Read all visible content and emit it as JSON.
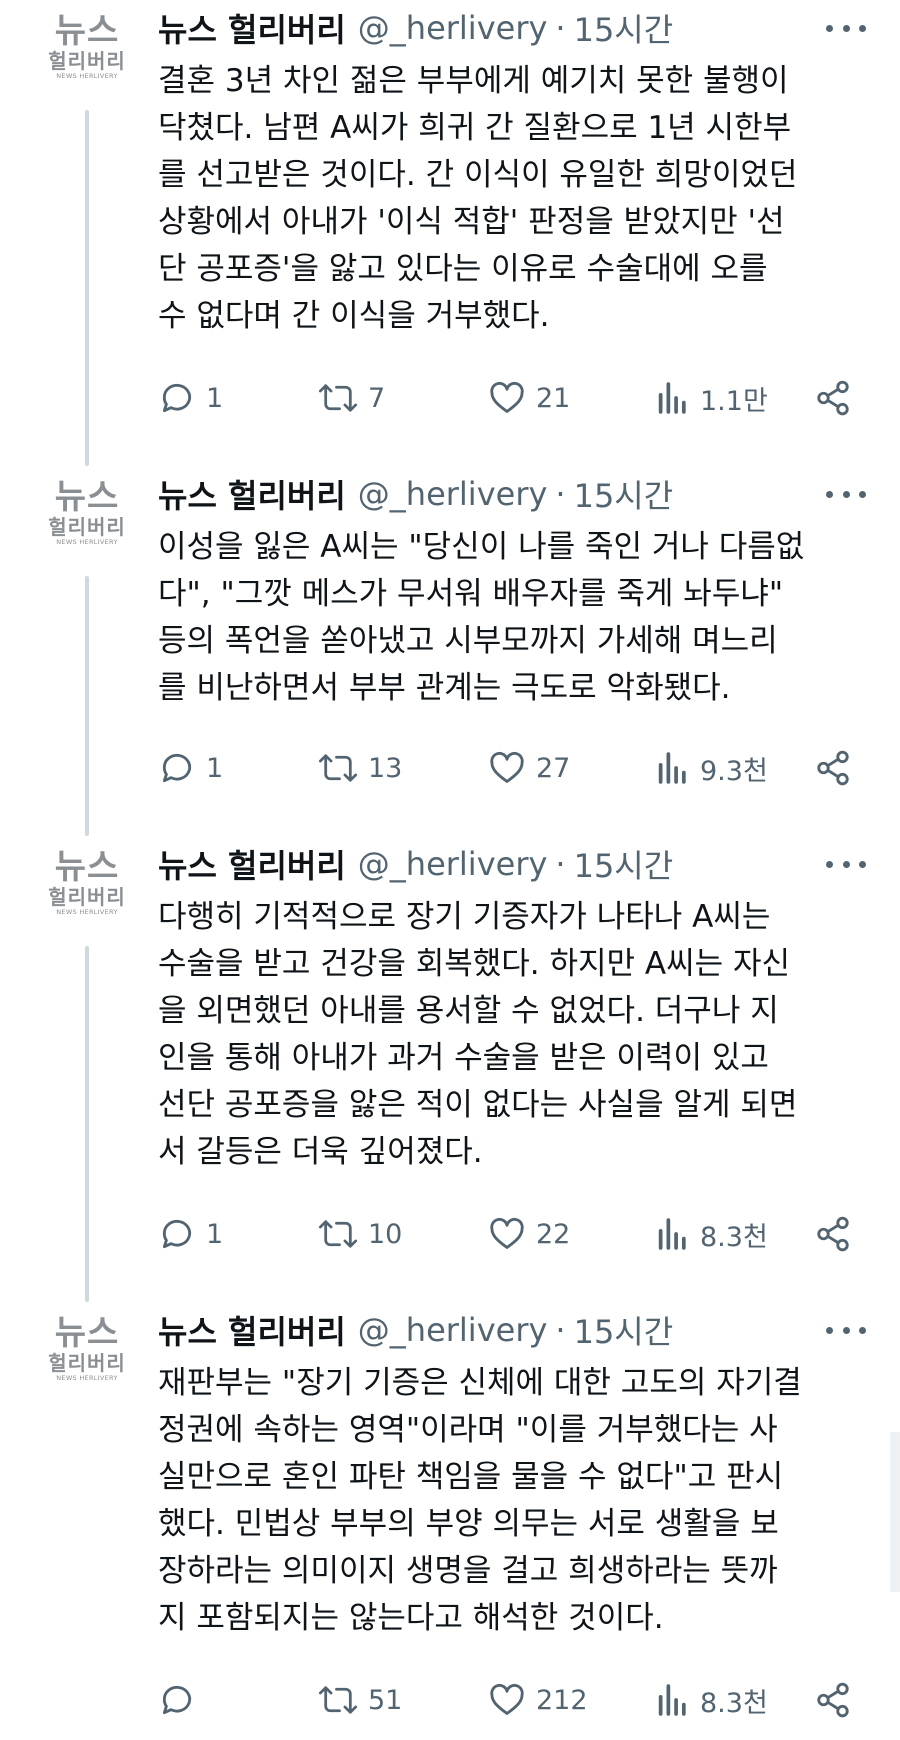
{
  "author": {
    "name": "뉴스 헐리버리",
    "handle": "@_herlivery",
    "avatar_line1": "뉴스",
    "avatar_line2": "헐리버리",
    "avatar_line3": "NEWS HERLIVERY"
  },
  "separator": "·",
  "tweets": [
    {
      "time": "15시간",
      "text": "결혼 3년 차인 젊은 부부에게 예기치 못한 불행이\n닥쳤다. 남편 A씨가 희귀 간 질환으로 1년 시한부\n를 선고받은 것이다. 간 이식이 유일한 희망이었던\n상황에서 아내가 '이식 적합' 판정을 받았지만 '선\n단 공포증'을 앓고 있다는 이유로 수술대에 오를\n수 없다며 간 이식을 거부했다.",
      "replies": "1",
      "retweets": "7",
      "likes": "21",
      "views": "1.1만"
    },
    {
      "time": "15시간",
      "text": "이성을 잃은 A씨는 \"당신이 나를 죽인 거나 다름없\n다\", \"그깟 메스가 무서워 배우자를 죽게 놔두냐\"\n등의 폭언을 쏟아냈고 시부모까지 가세해 며느리\n를 비난하면서 부부 관계는 극도로 악화됐다.",
      "replies": "1",
      "retweets": "13",
      "likes": "27",
      "views": "9.3천"
    },
    {
      "time": "15시간",
      "text": "다행히 기적적으로 장기 기증자가 나타나 A씨는\n수술을 받고 건강을 회복했다. 하지만 A씨는 자신\n을 외면했던 아내를 용서할 수 없었다. 더구나 지\n인을 통해 아내가 과거 수술을 받은 이력이 있고\n선단 공포증을 앓은 적이 없다는 사실을 알게 되면\n서 갈등은 더욱 깊어졌다.",
      "replies": "1",
      "retweets": "10",
      "likes": "22",
      "views": "8.3천"
    },
    {
      "time": "15시간",
      "text": "재판부는 \"장기 기증은 신체에 대한 고도의 자기결\n정권에 속하는 영역\"이라며 \"이를 거부했다는 사\n실만으로 혼인 파탄 책임을 물을 수 없다\"고 판시\n했다. 민법상 부부의 부양 의무는 서로 생활을 보\n장하라는 의미이지 생명을 걸고 희생하라는 뜻까\n지 포함되지는 않는다고 해석한 것이다.",
      "replies": "",
      "retweets": "51",
      "likes": "212",
      "views": "8.3천"
    }
  ],
  "icons": {
    "reply": "reply-bubble-icon",
    "retweet": "retweet-arrows-icon",
    "like": "heart-icon",
    "views": "views-bar-chart-icon",
    "share": "share-icon",
    "more": "more-dots-icon"
  },
  "colors": {
    "text": "#0f1419",
    "secondary": "#536471",
    "thread_line": "#cfd9de",
    "avatar_gray": "#8a8f94"
  }
}
